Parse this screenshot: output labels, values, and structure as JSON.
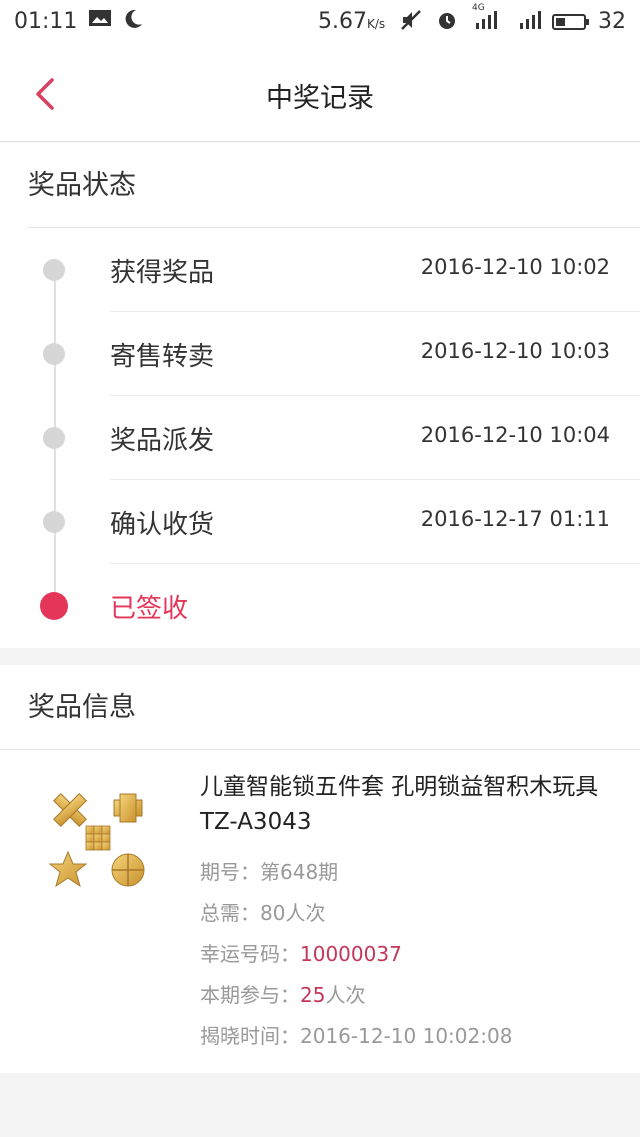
{
  "status_bar": {
    "time": "01:11",
    "speed": "5.67",
    "speed_unit": "K/s",
    "network": "4G",
    "battery": "32"
  },
  "nav": {
    "title": "中奖记录"
  },
  "prize_status": {
    "heading": "奖品状态",
    "steps": [
      {
        "label": "获得奖品",
        "time": "2016-12-10 10:02"
      },
      {
        "label": "寄售转卖",
        "time": "2016-12-10 10:03"
      },
      {
        "label": "奖品派发",
        "time": "2016-12-10 10:04"
      },
      {
        "label": "确认收货",
        "time": "2016-12-17 01:11"
      },
      {
        "label": "已签收",
        "time": ""
      }
    ]
  },
  "prize_info": {
    "heading": "奖品信息",
    "title": "儿童智能锁五件套 孔明锁益智积木玩具 TZ-A3043",
    "period_label": "期号：",
    "period_value": "第648期",
    "total_label": "总需：",
    "total_value": "80人次",
    "lucky_label": "幸运号码：",
    "lucky_value": "10000037",
    "join_label": "本期参与：",
    "join_count": "25",
    "join_unit": "人次",
    "reveal_label": "揭晓时间：",
    "reveal_value": "2016-12-10 10:02:08"
  },
  "colors": {
    "accent": "#e5365a",
    "dot_inactive": "#d6d6d6"
  }
}
